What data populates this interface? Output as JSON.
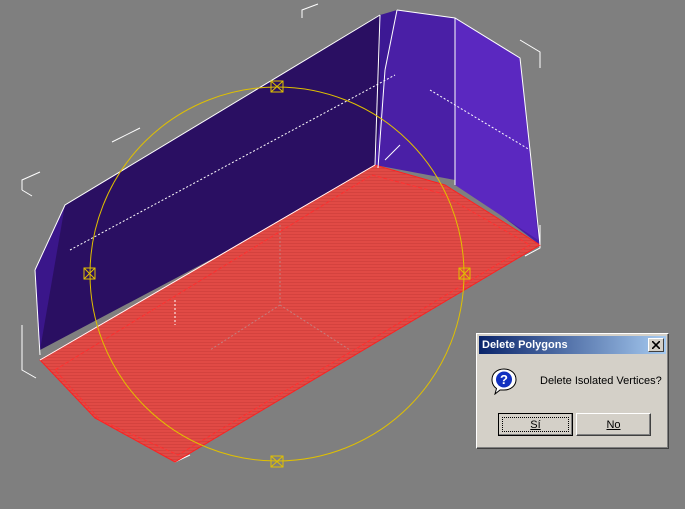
{
  "viewport": {
    "background": "#7f7f7f",
    "colors": {
      "box_dark": "#2a0f62",
      "box_purple": "#4a1fa6",
      "box_light": "#5b28c0",
      "selected_face": "#e14a45",
      "gizmo": "#e0c000"
    }
  },
  "dialog": {
    "title": "Delete Polygons",
    "message": "Delete Isolated Vertices?",
    "icon": "question-icon",
    "yes_label": "Sí",
    "no_label": "No",
    "close_icon": "close-icon"
  }
}
